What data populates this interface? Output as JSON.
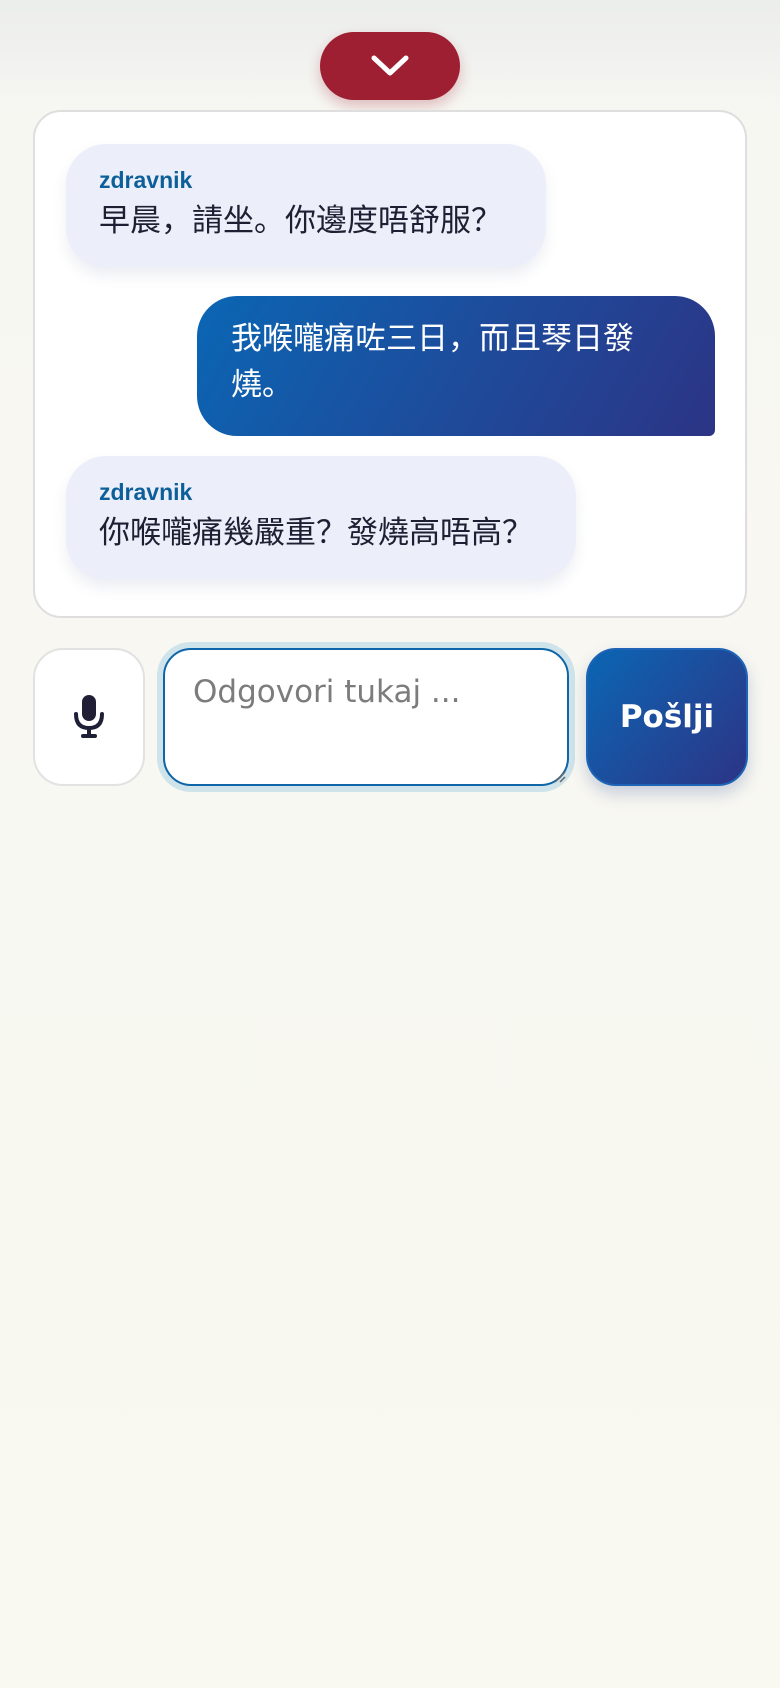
{
  "header": {
    "collapse_icon": "chevron-down-icon",
    "collapse_color": "#9e1f32"
  },
  "chat": {
    "messages": [
      {
        "role": "doctor",
        "sender": "zdravnik",
        "text": "早晨，請坐。你邊度唔舒服？"
      },
      {
        "role": "patient",
        "text_line1": "我喉嚨痛咗三日，而且琴日發",
        "text_line2": "燒。"
      },
      {
        "role": "doctor",
        "sender": "zdravnik",
        "text": "你喉嚨痛幾嚴重？發燒高唔高？"
      }
    ]
  },
  "composer": {
    "mic_icon": "microphone-icon",
    "placeholder": "Odgovori tukaj ...",
    "value": "",
    "send_label": "Pošlji",
    "accent": "#0a66b4"
  }
}
